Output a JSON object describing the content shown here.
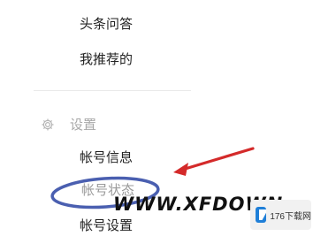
{
  "menu": {
    "items_top": [
      "头条问答",
      "我推荐的"
    ],
    "section": {
      "label": "设置",
      "icon": "gear-icon",
      "items": [
        "帐号信息",
        "帐号状态",
        "帐号设置"
      ]
    }
  },
  "watermark": {
    "text": "WWW.XFDOWN",
    "logo_text": "176下载网"
  },
  "colors": {
    "annotation_arrow": "#d42a2a",
    "annotation_circle": "#4a5fb0",
    "section_label": "#a8a8a8",
    "logo_blue": "#1f7fd8"
  }
}
